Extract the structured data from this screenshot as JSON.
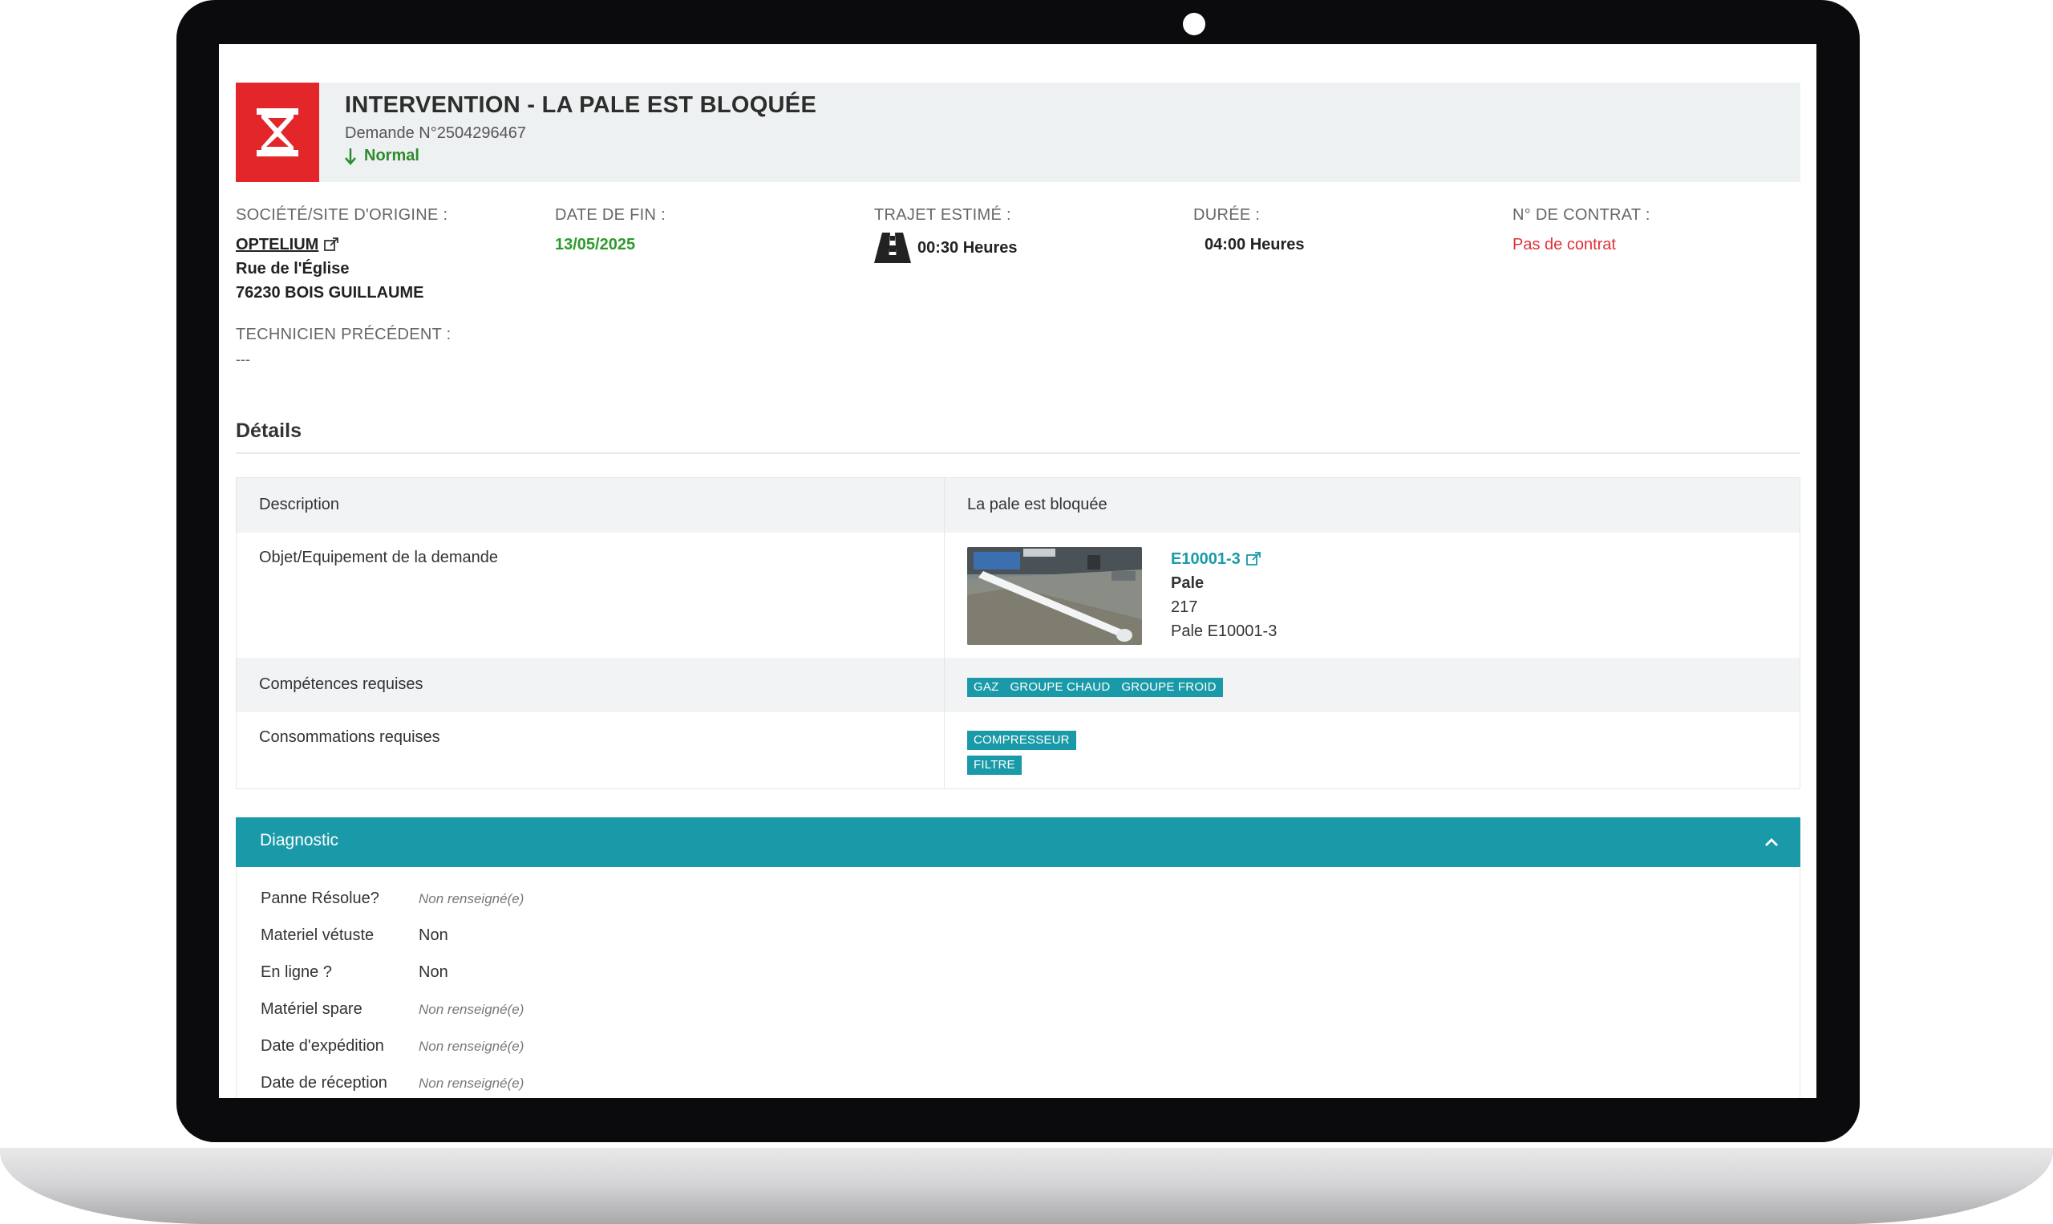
{
  "header": {
    "title": "INTERVENTION - LA PALE EST BLOQUÉE",
    "request_number": "Demande N°2504296467",
    "priority": "Normal",
    "status_icon": "hourglass-icon"
  },
  "info": {
    "origin": {
      "label": "SOCIÉTÉ/SITE D'ORIGINE :",
      "company": "OPTELIUM",
      "street": "Rue de l'Église",
      "city": "76230 BOIS GUILLAUME"
    },
    "end_date": {
      "label": "DATE DE FIN :",
      "value": "13/05/2025"
    },
    "travel": {
      "label": "TRAJET ESTIMÉ :",
      "value": "00:30 Heures",
      "icon": "road-icon"
    },
    "duration": {
      "label": "DURÉE :",
      "value": "04:00 Heures"
    },
    "contract": {
      "label": "N° DE CONTRAT :",
      "value": "Pas de contrat"
    },
    "previous_technician": {
      "label": "TECHNICIEN PRÉCÉDENT :",
      "value": "---"
    }
  },
  "details": {
    "title": "Détails",
    "description": {
      "label": "Description",
      "value": "La pale est bloquée"
    },
    "equipment": {
      "label": "Objet/Equipement de la demande",
      "code": "E10001-3",
      "type": "Pale",
      "number": "217",
      "name": "Pale E10001-3"
    },
    "skills": {
      "label": "Compétences requises",
      "tags": [
        "GAZ",
        "GROUPE CHAUD",
        "GROUPE FROID"
      ]
    },
    "consumables": {
      "label": "Consommations requises",
      "tags": [
        "COMPRESSEUR",
        "FILTRE"
      ]
    }
  },
  "diagnostic": {
    "title": "Diagnostic",
    "rows": [
      {
        "label": "Panne Résolue?",
        "value": "Non renseigné(e)"
      },
      {
        "label": "Materiel vétuste",
        "value": "Non"
      },
      {
        "label": "En ligne ?",
        "value": "Non"
      },
      {
        "label": "Matériel spare",
        "value": "Non renseigné(e)"
      },
      {
        "label": "Date d'expédition",
        "value": "Non renseigné(e)"
      },
      {
        "label": "Date de réception",
        "value": "Non renseigné(e)"
      }
    ]
  },
  "colors": {
    "accent": "#1a9aa8",
    "alert": "#e3262a",
    "success": "#2e9a2e"
  }
}
